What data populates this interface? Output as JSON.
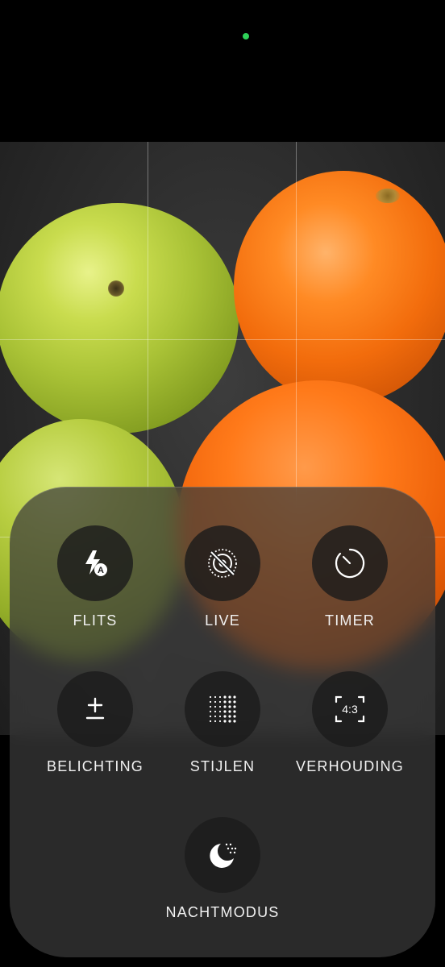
{
  "camera": {
    "controls": [
      {
        "id": "flash",
        "label": "FLITS",
        "icon": "flash-auto-icon"
      },
      {
        "id": "live",
        "label": "LIVE",
        "icon": "live-off-icon"
      },
      {
        "id": "timer",
        "label": "TIMER",
        "icon": "timer-icon"
      },
      {
        "id": "exposure",
        "label": "BELICHTING",
        "icon": "exposure-icon"
      },
      {
        "id": "styles",
        "label": "STIJLEN",
        "icon": "styles-grid-icon"
      },
      {
        "id": "aspect",
        "label": "VERHOUDING",
        "icon": "aspect-ratio-icon"
      },
      {
        "id": "night",
        "label": "NACHTMODUS",
        "icon": "night-mode-icon"
      }
    ],
    "aspect_ratio_text": "4:3",
    "flash_badge": "A"
  },
  "colors": {
    "status_dot": "#2ed158",
    "panel": "#3a3a3a",
    "button": "#1c1c1c",
    "label": "#f2f2f2"
  }
}
